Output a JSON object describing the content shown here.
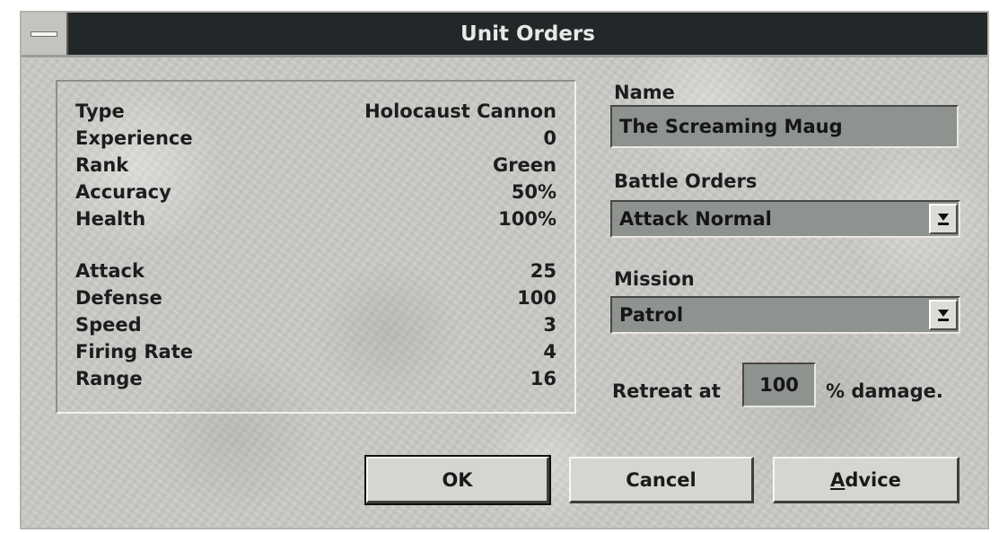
{
  "window": {
    "title": "Unit Orders"
  },
  "stats": {
    "group1": [
      {
        "label": "Type",
        "value": "Holocaust Cannon"
      },
      {
        "label": "Experience",
        "value": "0"
      },
      {
        "label": "Rank",
        "value": "Green"
      },
      {
        "label": "Accuracy",
        "value": "50%"
      },
      {
        "label": "Health",
        "value": "100%"
      }
    ],
    "group2": [
      {
        "label": "Attack",
        "value": "25"
      },
      {
        "label": "Defense",
        "value": "100"
      },
      {
        "label": "Speed",
        "value": "3"
      },
      {
        "label": "Firing Rate",
        "value": "4"
      },
      {
        "label": "Range",
        "value": "16"
      }
    ]
  },
  "name": {
    "label": "Name",
    "value": "The Screaming Maug"
  },
  "battle_orders": {
    "label": "Battle Orders",
    "value": "Attack Normal"
  },
  "mission": {
    "label": "Mission",
    "value": "Patrol"
  },
  "retreat": {
    "prefix": "Retreat at",
    "value": "100",
    "suffix": "% damage."
  },
  "buttons": {
    "ok": "OK",
    "cancel": "Cancel",
    "advice": "Advice"
  },
  "colors": {
    "title_bar": "#22282a",
    "field_bg": "#8f938f",
    "dialog_bg": "#c9c8c4"
  }
}
